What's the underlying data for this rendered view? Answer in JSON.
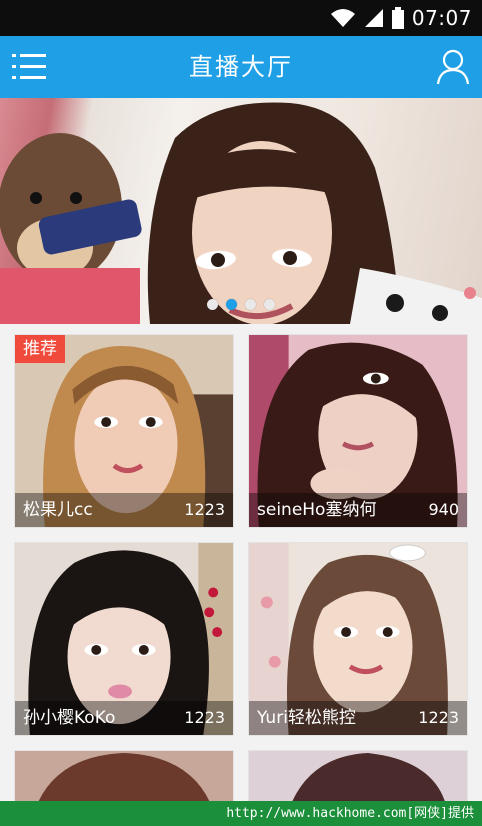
{
  "status_bar": {
    "time": "07:07",
    "icons": [
      "wifi-icon",
      "signal-icon",
      "battery-icon"
    ]
  },
  "header": {
    "title": "直播大厅",
    "menu_icon": "menu-icon",
    "user_icon": "user-icon"
  },
  "banner": {
    "dots": 4,
    "active_dot_index": 1,
    "accent_color": "#1fa0e6"
  },
  "cards": [
    {
      "name": "松果儿cc",
      "count": "1223",
      "badge": "推荐"
    },
    {
      "name": "seineHo塞纳何",
      "count": "940",
      "badge": ""
    },
    {
      "name": "孙小樱KoKo",
      "count": "1223",
      "badge": ""
    },
    {
      "name": "Yuri轻松熊控",
      "count": "1223",
      "badge": ""
    }
  ],
  "watermark": {
    "text": "http://www.hackhome.com[网侠]提供"
  },
  "colors": {
    "header_bg": "#1fa0e6",
    "badge_bg": "#ef4a3c",
    "watermark_bg": "#1b8f3a"
  }
}
